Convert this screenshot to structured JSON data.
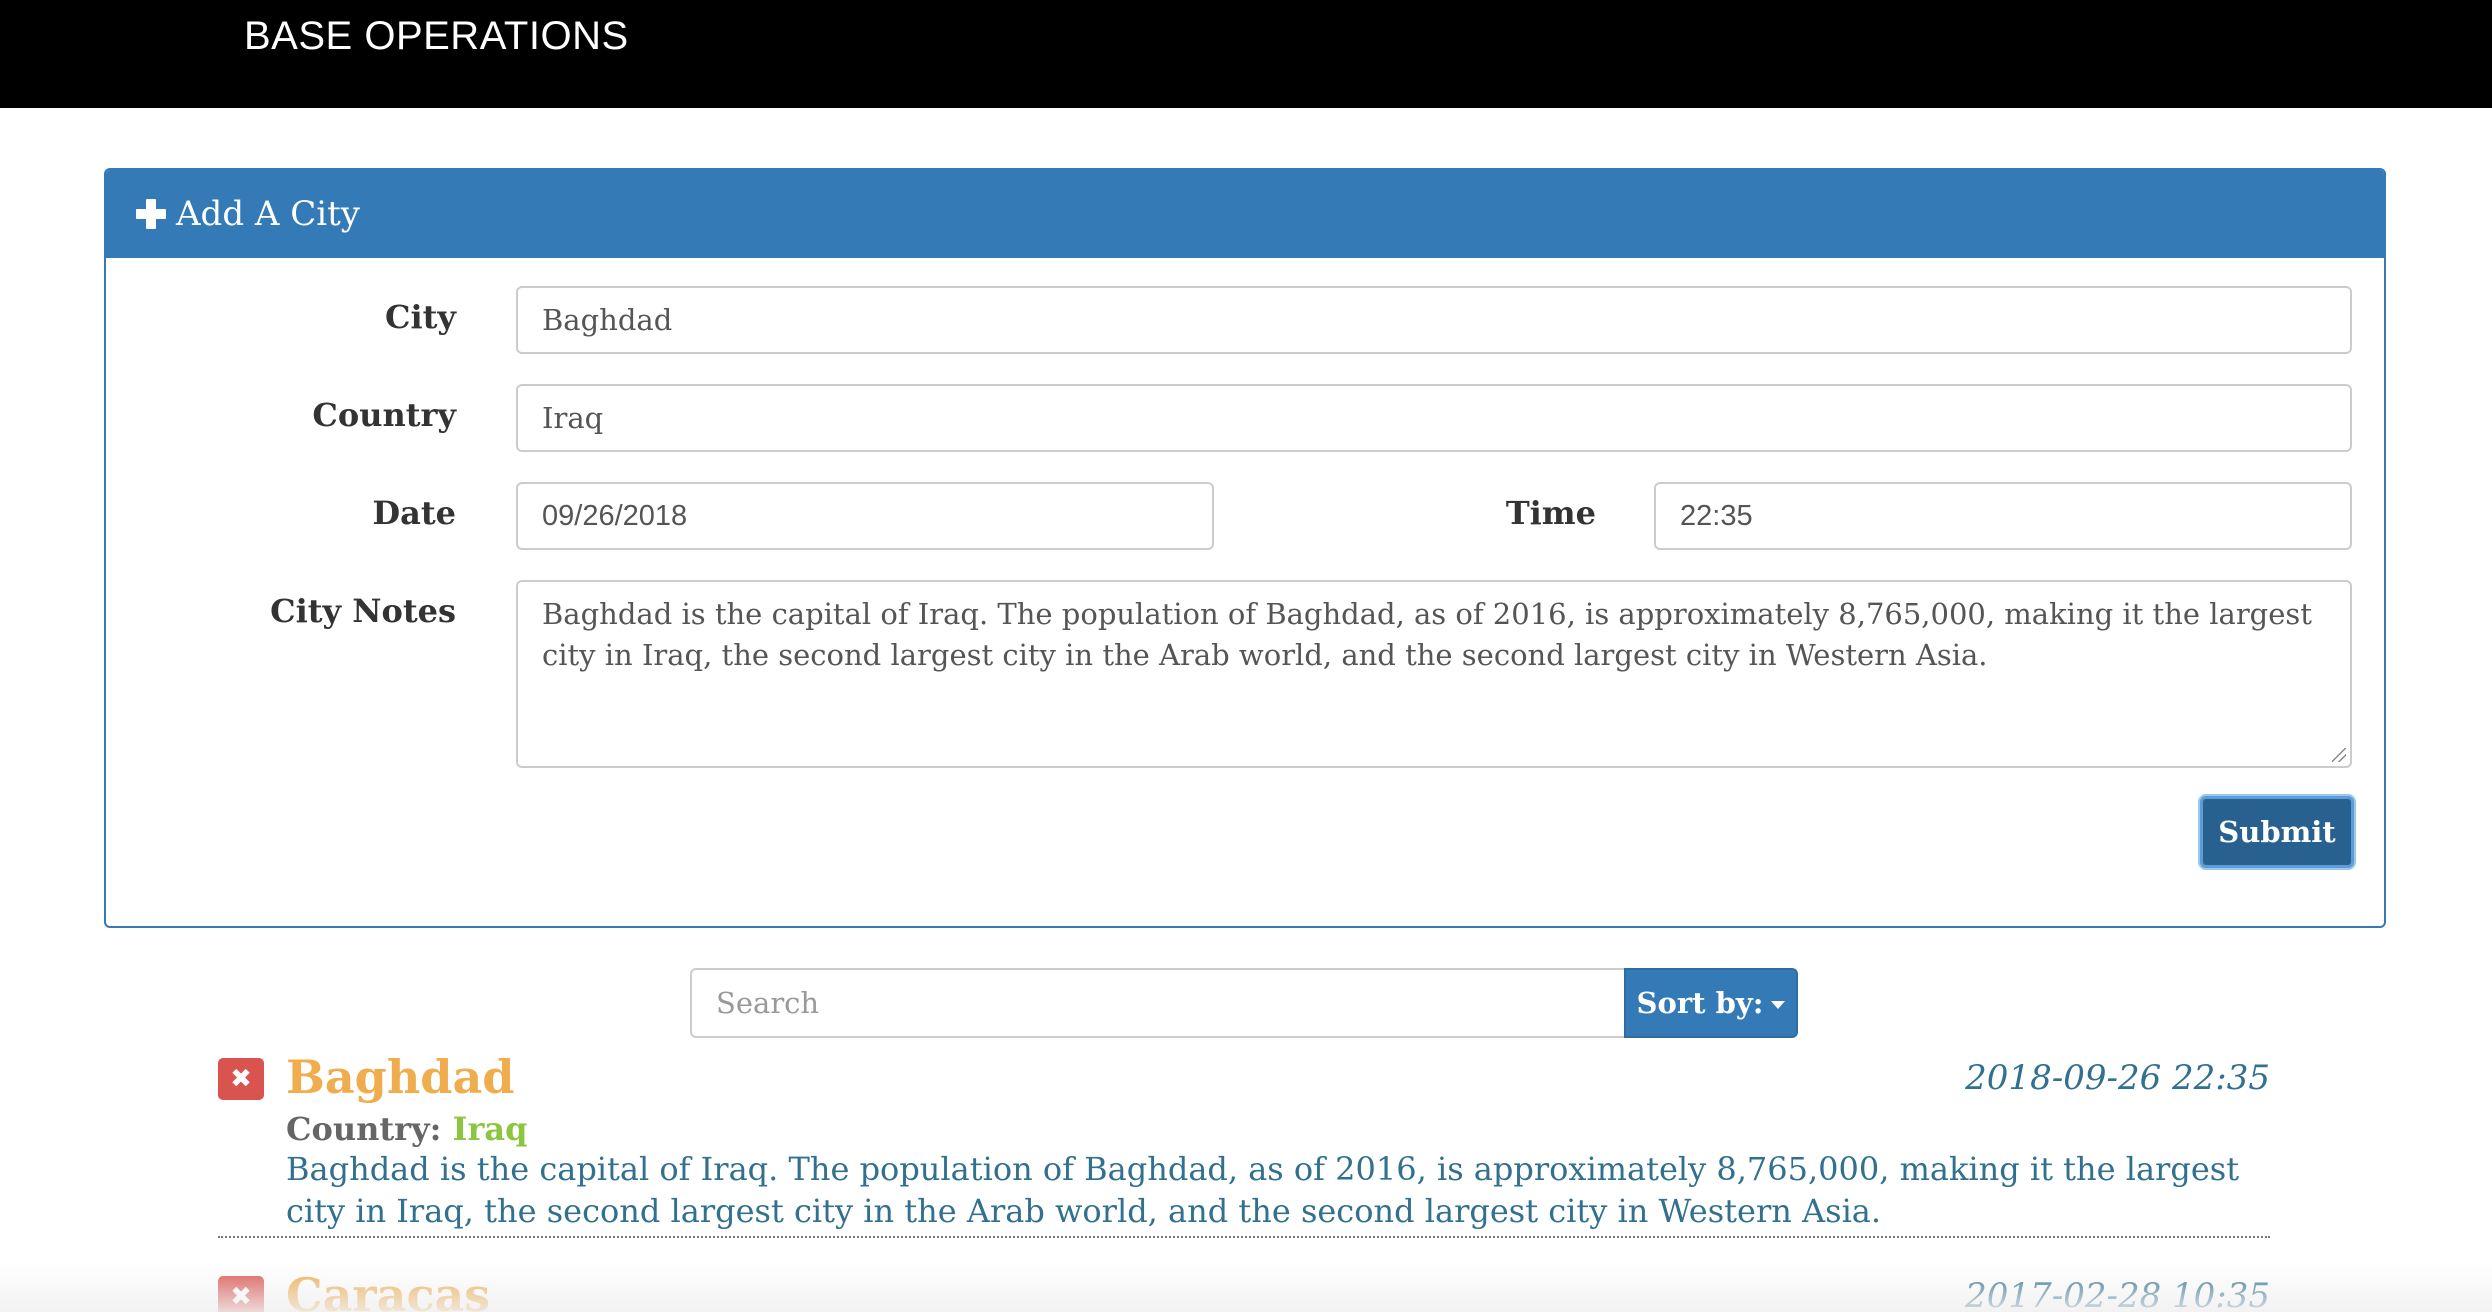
{
  "navbar": {
    "brand": "BASE OPERATIONS"
  },
  "panel": {
    "title": "Add A City",
    "icon": "plus-icon",
    "color": "#337ab7"
  },
  "form": {
    "city_label": "City",
    "city_value": "Baghdad",
    "country_label": "Country",
    "country_value": "Iraq",
    "date_label": "Date",
    "date_value": "09/26/2018",
    "time_label": "Time",
    "time_value": "22:35",
    "notes_label": "City Notes",
    "notes_value": "Baghdad is the capital of Iraq. The population of Baghdad, as of 2016, is approximately 8,765,000, making it the largest city in Iraq, the second largest city in the Arab world, and the second largest city in Western Asia.",
    "submit_label": "Submit"
  },
  "search": {
    "placeholder": "Search",
    "sort_label": "Sort by:"
  },
  "cities": [
    {
      "name": "Baghdad",
      "date": "2018-09-26 22:35",
      "country_label": "Country:",
      "country": "Iraq",
      "notes": "Baghdad is the capital of Iraq. The population of Baghdad, as of 2016, is approximately 8,765,000, making it the largest city in Iraq, the second largest city in the Arab world, and the second largest city in Western Asia."
    },
    {
      "name": "Caracas",
      "date": "2017-02-28 10:35"
    }
  ],
  "colors": {
    "city_name": "#f0ad4e",
    "country": "#8cc63f",
    "notes": "#31708f",
    "delete": "#d9534f"
  }
}
